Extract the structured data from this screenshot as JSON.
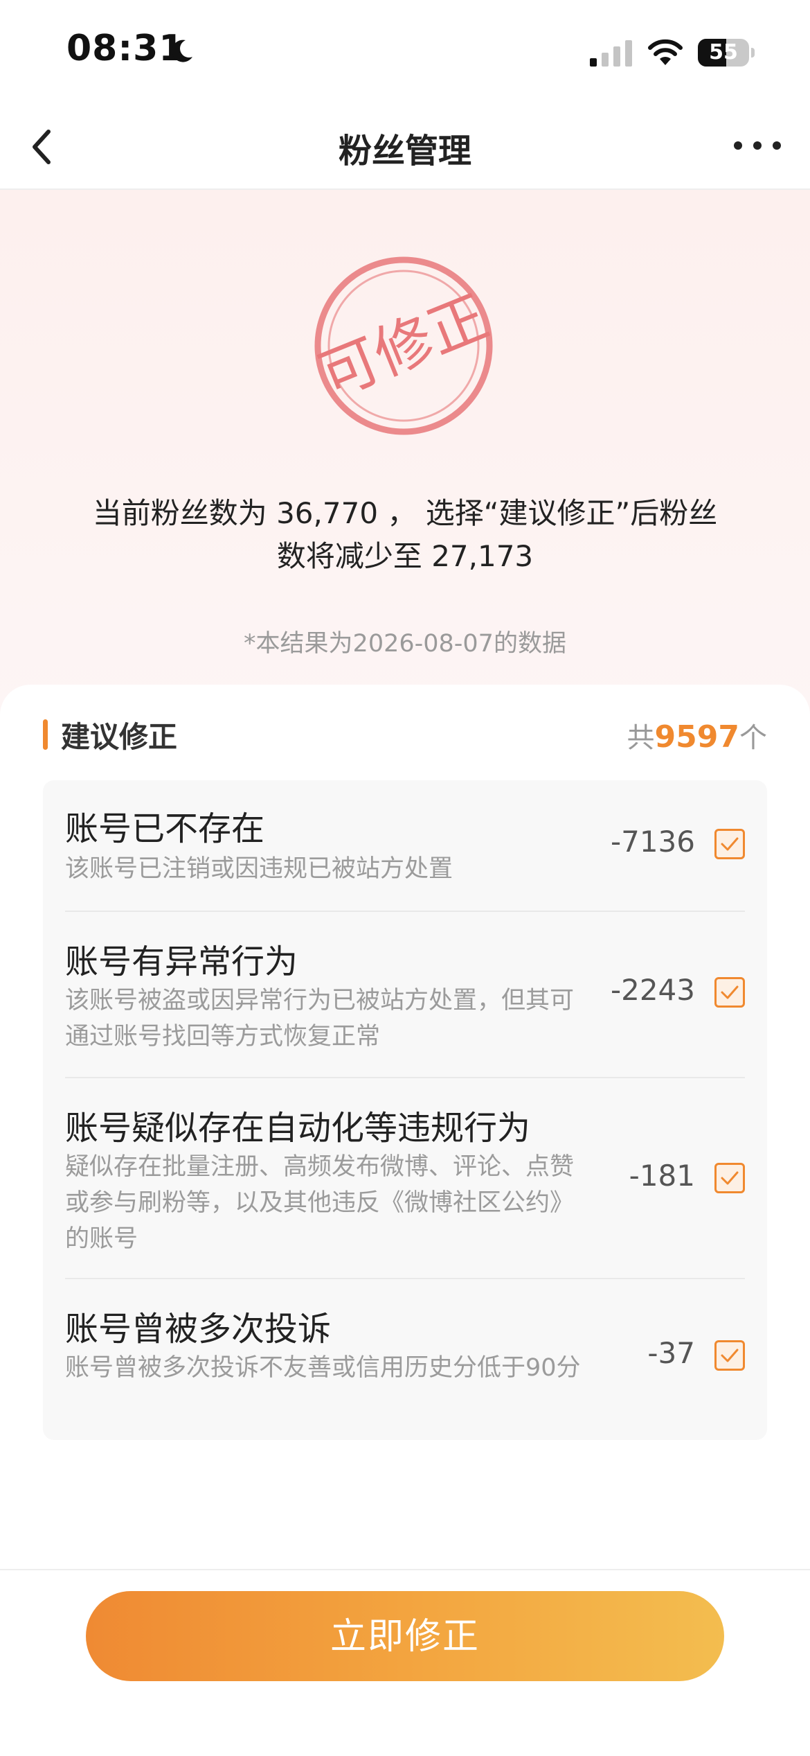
{
  "status_bar": {
    "time": "08:31",
    "battery": "55",
    "battery_level_percent": 55,
    "icons": [
      "moon-icon",
      "signal-icon",
      "wifi-icon",
      "battery-icon"
    ]
  },
  "nav": {
    "title": "粉丝管理",
    "icons": [
      "back-chevron-icon",
      "more-dots-icon"
    ]
  },
  "hero": {
    "stamp_text": "可修正",
    "summary_line1": "当前粉丝数为 36,770 ， 选择“建议修正”后粉丝",
    "summary_line2": "数将减少至 27,173",
    "note": "*本结果为2026-08-07的数据",
    "colors": {
      "stamp": "#e8787a",
      "background": "#fdf0ee"
    }
  },
  "section": {
    "title": "建议修正",
    "total_prefix": "共",
    "total_count": "9597",
    "total_suffix": "个"
  },
  "items": [
    {
      "title": "账号已不存在",
      "desc": "该账号已注销或因违规已被站方处置",
      "delta": "-7136",
      "checked": true
    },
    {
      "title": "账号有异常行为",
      "desc": "该账号被盗或因异常行为已被站方处置，但其可通过账号找回等方式恢复正常",
      "delta": "-2243",
      "checked": true
    },
    {
      "title": "账号疑似存在自动化等违规行为",
      "desc": "疑似存在批量注册、高频发布微博、评论、点赞或参与刷粉等，以及其他违反《微博社区公约》的账号",
      "delta": "-181",
      "checked": true
    },
    {
      "title": "账号曾被多次投诉",
      "desc": "账号曾被多次投诉不友善或信用历史分低于90分",
      "delta": "-37",
      "checked": true
    }
  ],
  "footer": {
    "button_label": "立即修正"
  },
  "colors": {
    "accent": "#f0892f",
    "button_gradient_start": "#ef8a33",
    "button_gradient_end": "#f3bd4f"
  }
}
